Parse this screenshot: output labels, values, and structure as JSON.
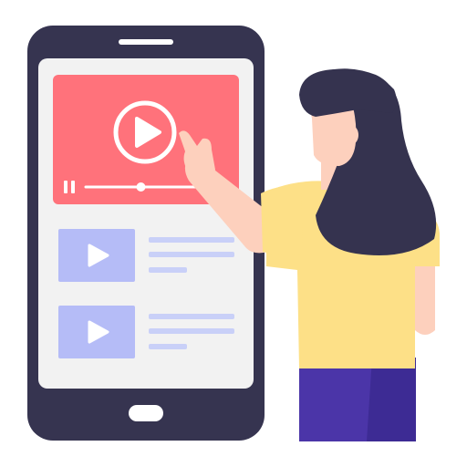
{
  "colors": {
    "phone_body": "#363450",
    "screen": "#f2f2f2",
    "featured_video": "#ff727b",
    "thumbnail": "#b5bcf7",
    "text_line": "#c9d0f8",
    "skin": "#fdd0bd",
    "hair": "#35334f",
    "shirt": "#fde087",
    "pants": "#4b35a8",
    "pants_shade": "#3d2b94"
  },
  "icons": {
    "featured_play": "play-icon",
    "pause": "pause-icon",
    "thumbnail_play": "play-icon"
  },
  "featured_video": {
    "progress": 0.42
  },
  "video_list": [
    {
      "thumbnail_icon": "play-icon"
    },
    {
      "thumbnail_icon": "play-icon"
    }
  ]
}
